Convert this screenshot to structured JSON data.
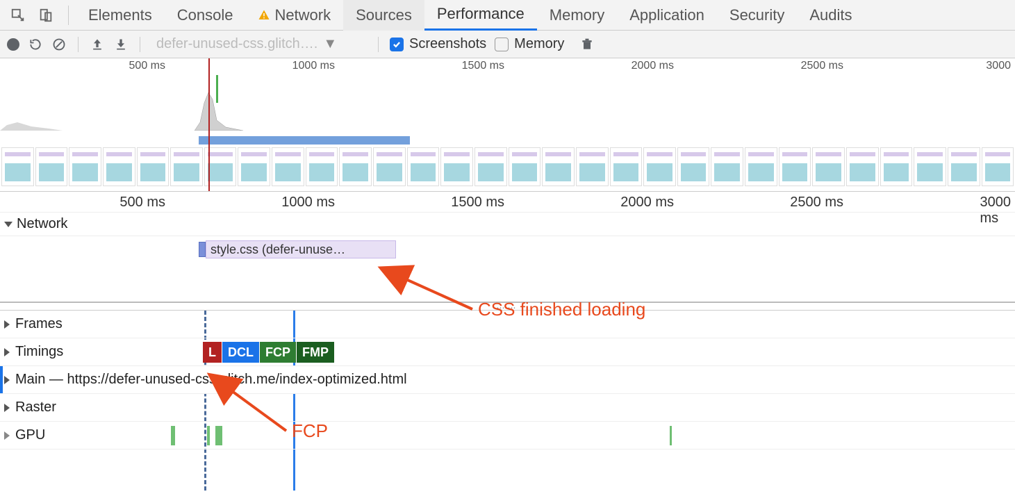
{
  "tabs": {
    "elements": "Elements",
    "console": "Console",
    "network": "Network",
    "sources": "Sources",
    "performance": "Performance",
    "memory": "Memory",
    "application": "Application",
    "security": "Security",
    "audits": "Audits"
  },
  "toolbar": {
    "dropdown": "defer-unused-css.glitch….",
    "screenshots": "Screenshots",
    "memory": "Memory"
  },
  "overview_ticks": {
    "t500": "500 ms",
    "t1000": "1000 ms",
    "t1500": "1500 ms",
    "t2000": "2000 ms",
    "t2500": "2500 ms",
    "t3000": "3000"
  },
  "detail_ticks": {
    "t500": "500 ms",
    "t1000": "1000 ms",
    "t1500": "1500 ms",
    "t2000": "2000 ms",
    "t2500": "2500 ms",
    "t3000": "3000 ms"
  },
  "sections": {
    "network": "Network",
    "frames": "Frames",
    "timings": "Timings",
    "main": "Main — https://defer-unused-css.glitch.me/index-optimized.html",
    "raster": "Raster",
    "gpu": "GPU"
  },
  "network_item": "style.css (defer-unuse…",
  "timings_badges": {
    "l": "L",
    "dcl": "DCL",
    "fcp": "FCP",
    "fmp": "FMP"
  },
  "annotations": {
    "css": "CSS finished loading",
    "fcp": "FCP"
  }
}
